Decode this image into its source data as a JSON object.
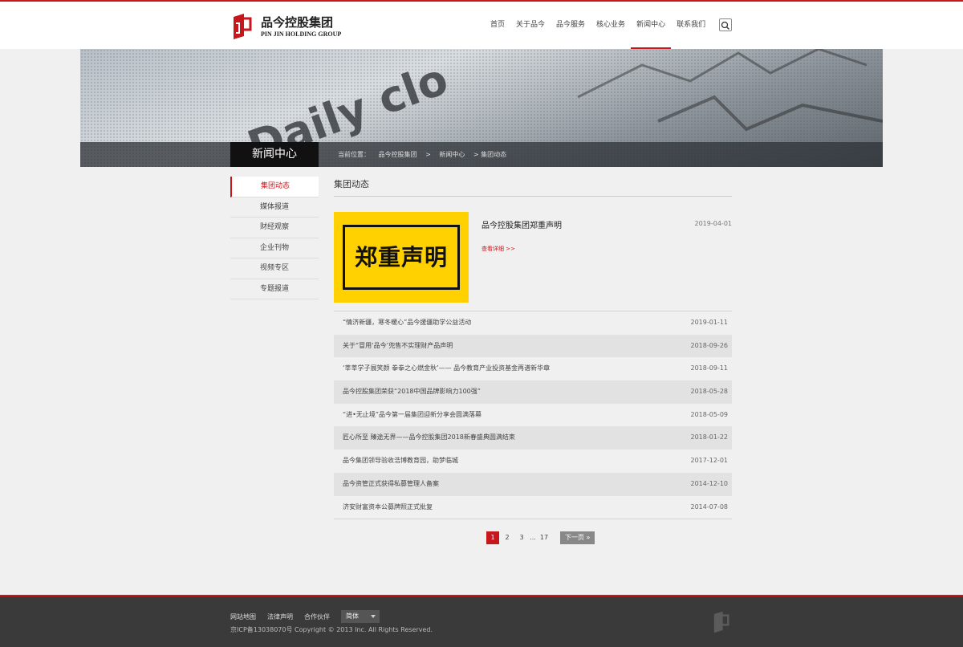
{
  "brand": {
    "name_cn": "品今控股集团",
    "name_en": "PIN JIN HOLDING GROUP",
    "accent": "#c8161d"
  },
  "nav": {
    "items": [
      "首页",
      "关于品今",
      "品今服务",
      "核心业务",
      "新闻中心",
      "联系我们"
    ],
    "active": "新闻中心",
    "search_icon": "search-icon"
  },
  "banner": {
    "image_text": "Daily clo"
  },
  "section": {
    "title": "新闻中心",
    "breadcrumb": {
      "prefix": "当前位置：",
      "items": [
        "品今控股集团",
        ">",
        "新闻中心",
        "> 集团动态"
      ]
    }
  },
  "sidebar": {
    "items": [
      "集团动态",
      "媒体报道",
      "财经观察",
      "企业刊物",
      "视频专区",
      "专题报道"
    ],
    "active": "集团动态"
  },
  "main": {
    "title": "集团动态",
    "featured": {
      "image_text": "郑重声明",
      "title": "品今控股集团郑重声明",
      "date": "2019-04-01",
      "more": "查看详细 >>"
    },
    "list": [
      {
        "title": "“情济新疆，寒冬暖心”品今援疆助学公益活动",
        "date": "2019-01-11"
      },
      {
        "title": "关于“冒用‘品今’兜售不实理财产品声明",
        "date": "2018-09-26"
      },
      {
        "title": "‘莘莘学子展笑颜 拳拳之心燃金秋’—— 品今教育产业投资基金再谱新华章",
        "date": "2018-09-11"
      },
      {
        "title": "品今控股集团荣获“2018中国品牌影响力100强”",
        "date": "2018-05-28"
      },
      {
        "title": "“进•无止境”品今第一届集团迎新分享会圆满落幕",
        "date": "2018-05-09"
      },
      {
        "title": "匠心所至 臻途无界——品今控股集团2018新春盛典圆满结束",
        "date": "2018-01-22"
      },
      {
        "title": "品今集团领导验收浩博教育园，助梦临城",
        "date": "2017-12-01"
      },
      {
        "title": "品今资管正式获得私募管理人备案",
        "date": "2014-12-10"
      },
      {
        "title": "济安财富资本公募牌照正式批复",
        "date": "2014-07-08"
      }
    ],
    "pagination": {
      "pages": [
        "1",
        "2",
        "3"
      ],
      "ellipsis": "...",
      "last": "17",
      "next": "下一页 »",
      "current": "1"
    }
  },
  "footer": {
    "links": [
      "网站地图",
      "法律声明",
      "合作伙伴"
    ],
    "language": "简体",
    "copyright": "京ICP备13038070号 Copyright © 2013 Inc. All Rights Reserved."
  }
}
